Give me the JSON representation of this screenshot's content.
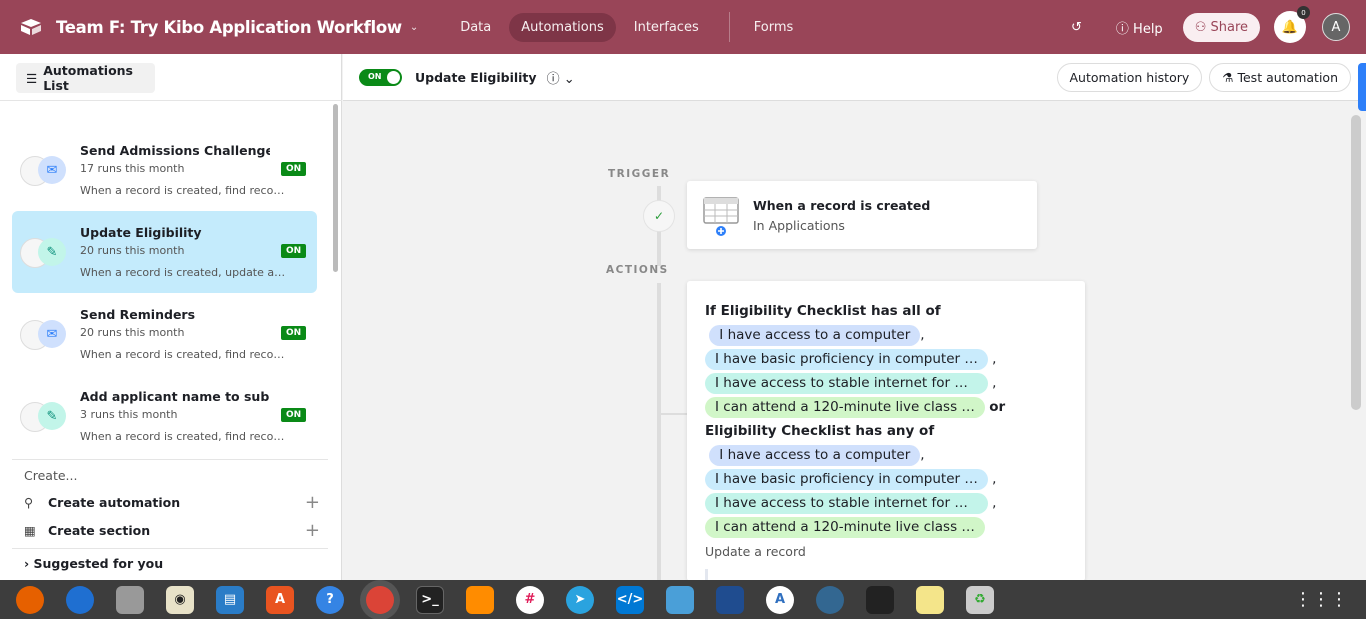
{
  "header": {
    "title": "Team F: Try Kibo Application Workflow",
    "nav": [
      "Data",
      "Automations",
      "Interfaces",
      "Forms"
    ],
    "active_nav": "Automations",
    "help": "Help",
    "share": "Share",
    "notifications": "0",
    "avatar": "A",
    "color": "#994558"
  },
  "sidebar": {
    "list_button": "Automations List",
    "items": [
      {
        "name": "Send Admissions Challenge",
        "runs": "17 runs this month",
        "desc": "When a record is created, find reco…",
        "status": "ON",
        "icon": "email-icon"
      },
      {
        "name": "Update Eligibility",
        "runs": "20 runs this month",
        "desc": "When a record is created, update a…",
        "status": "ON",
        "icon": "pencil-icon",
        "selected": true
      },
      {
        "name": "Send Reminders",
        "runs": "20 runs this month",
        "desc": "When a record is created, find reco…",
        "status": "ON",
        "icon": "email-icon"
      },
      {
        "name": "Add applicant name to subm…",
        "runs": "3 runs this month",
        "desc": "When a record is created, find reco…",
        "status": "ON",
        "icon": "pencil-icon"
      }
    ],
    "create_label": "Create...",
    "create_automation": "Create automation",
    "create_section": "Create section",
    "suggested": "Suggested for you"
  },
  "toolbar": {
    "toggle": "ON",
    "automation_name": "Update Eligibility",
    "history": "Automation history",
    "test": "Test automation"
  },
  "canvas": {
    "trigger_label": "TRIGGER",
    "actions_label": "ACTIONS",
    "trigger": {
      "title": "When a record is created",
      "subtitle": "In Applications"
    },
    "condition": {
      "line1": "If Eligibility Checklist has all of",
      "line2": "Eligibility Checklist has any of",
      "or": "or",
      "options": [
        "I have access to a computer",
        "I have basic proficiency in computer …",
        "I have access to stable internet for …",
        "I can attend a 120-minute live class …"
      ],
      "option_colors": [
        "#d0e0fc",
        "#c9ebfc",
        "#c3f4ea",
        "#d1f6c8"
      ]
    },
    "action_label": "Update a record"
  },
  "taskbar": [
    "Firefox",
    "Thunderbird",
    "Files",
    "Rhythmbox",
    "Writer",
    "App Center",
    "Help",
    "Chrome",
    "Terminal",
    "Sublime",
    "Slack",
    "Telegram",
    "VS Code",
    "Shotwell",
    "VirtualBox",
    "Android Studio",
    "pgAdmin",
    "App",
    "Notes",
    "Trash"
  ]
}
